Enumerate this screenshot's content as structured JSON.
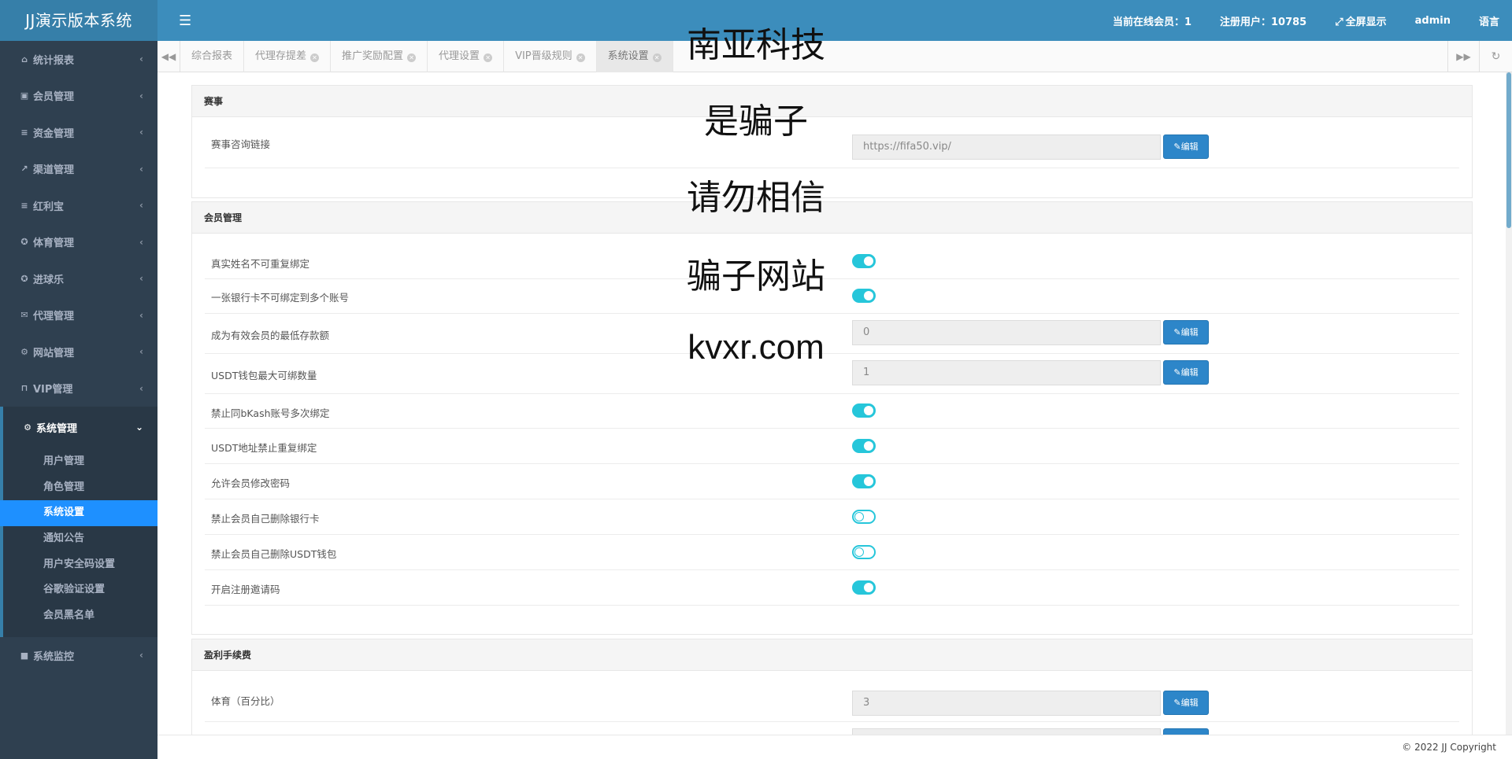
{
  "brand": "JJ演示版本系统",
  "sidebar": {
    "items": [
      {
        "label": "统计报表",
        "icon": "home-icon"
      },
      {
        "label": "会员管理",
        "icon": "id-card-icon"
      },
      {
        "label": "资金管理",
        "icon": "database-icon"
      },
      {
        "label": "渠道管理",
        "icon": "rocket-icon"
      },
      {
        "label": "红利宝",
        "icon": "list-icon"
      },
      {
        "label": "体育管理",
        "icon": "soccer-ball-icon"
      },
      {
        "label": "进球乐",
        "icon": "soccer-ball-icon"
      },
      {
        "label": "代理管理",
        "icon": "envelope-icon"
      },
      {
        "label": "网站管理",
        "icon": "cogs-icon"
      },
      {
        "label": "VIP管理",
        "icon": "lock-icon"
      },
      {
        "label": "系统管理",
        "icon": "gear-icon"
      },
      {
        "label": "系统监控",
        "icon": "video-camera-icon"
      }
    ],
    "submenu": [
      "用户管理",
      "角色管理",
      "系统设置",
      "通知公告",
      "用户安全码设置",
      "谷歌验证设置",
      "会员黑名单"
    ],
    "submenu_active": "系统设置"
  },
  "header": {
    "online": "当前在线会员：1",
    "registered": "注册用户：10785",
    "fullscreen": "全屏显示",
    "user": "admin",
    "language": "语言"
  },
  "tabs": [
    {
      "label": "综合报表",
      "closable": false
    },
    {
      "label": "代理存提差",
      "closable": true
    },
    {
      "label": "推广奖励配置",
      "closable": true
    },
    {
      "label": "代理设置",
      "closable": true
    },
    {
      "label": "VIP晋级规则",
      "closable": true
    },
    {
      "label": "系统设置",
      "closable": true,
      "active": true
    }
  ],
  "sections": {
    "event": {
      "title": "赛事",
      "rows": [
        {
          "label": "赛事咨询链接",
          "value": "https://fifa50.vip/",
          "button": "编辑"
        }
      ]
    },
    "member": {
      "title": "会员管理",
      "rows": [
        {
          "label": "真实姓名不可重复绑定",
          "toggle": true
        },
        {
          "label": "一张银行卡不可绑定到多个账号",
          "toggle": true
        },
        {
          "label": "成为有效会员的最低存款额",
          "value": "0",
          "button": "编辑"
        },
        {
          "label": "USDT钱包最大可绑数量",
          "value": "1",
          "button": "编辑"
        },
        {
          "label": "禁止同bKash账号多次绑定",
          "toggle": true
        },
        {
          "label": "USDT地址禁止重复绑定",
          "toggle": true
        },
        {
          "label": "允许会员修改密码",
          "toggle": true
        },
        {
          "label": "禁止会员自己删除银行卡",
          "toggle": false
        },
        {
          "label": "禁止会员自己删除USDT钱包",
          "toggle": false
        },
        {
          "label": "开启注册邀请码",
          "toggle": true
        }
      ]
    },
    "profit": {
      "title": "盈利手续费",
      "rows": [
        {
          "label": "体育（百分比）",
          "value": "3",
          "button": "编辑"
        },
        {
          "label": "",
          "value": "",
          "button": ""
        }
      ]
    }
  },
  "footer": "© 2022 JJ Copyright",
  "watermark": [
    "南亚科技",
    "是骗子",
    "请勿相信",
    "骗子网站",
    "kvxr.com"
  ]
}
